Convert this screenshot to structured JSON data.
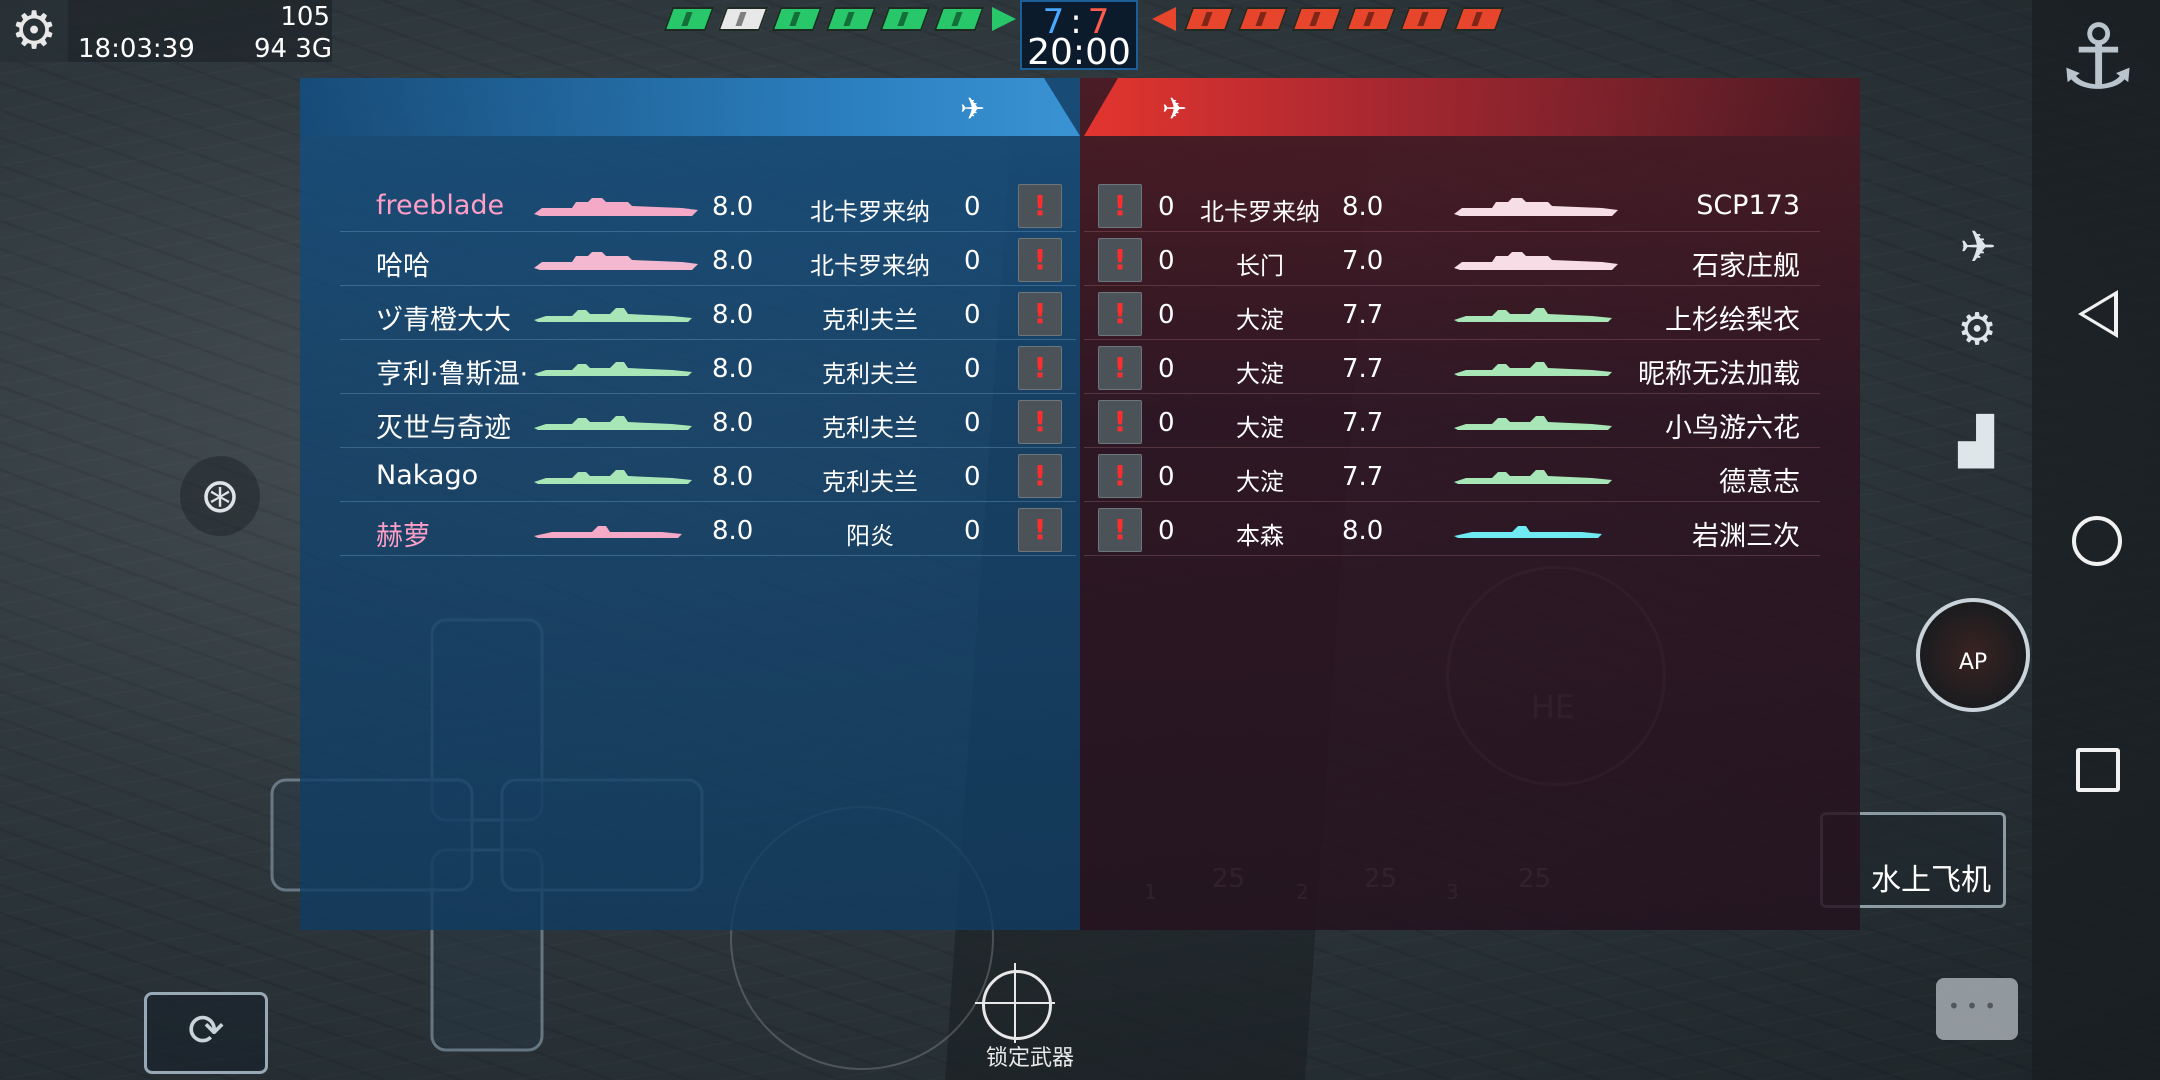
{
  "status": {
    "clock": "18:03:39",
    "fps": "105",
    "ping": "94",
    "network": "3G"
  },
  "score": {
    "blue": "7",
    "sep": ":",
    "red": "7",
    "timer": "20:00"
  },
  "colors": {
    "blue_team": "#2b7fbf",
    "red_team": "#e4352f",
    "blue_flag": "#27c76a",
    "red_flag": "#e7452c",
    "report_mark": "#ff2e2e"
  },
  "blue_team": {
    "header_icon": "airplane-icon",
    "players": [
      {
        "name": "freeblade",
        "tier": "8.0",
        "ship": "北卡罗来纳",
        "damage": "0",
        "highlight": true,
        "class": "battleship"
      },
      {
        "name": "哈哈",
        "tier": "8.0",
        "ship": "北卡罗来纳",
        "damage": "0",
        "highlight": false,
        "class": "battleship"
      },
      {
        "name": "ヅ青橙大大",
        "tier": "8.0",
        "ship": "克利夫兰",
        "damage": "0",
        "highlight": false,
        "class": "cruiser"
      },
      {
        "name": "亨利·鲁斯温·",
        "tier": "8.0",
        "ship": "克利夫兰",
        "damage": "0",
        "highlight": false,
        "class": "cruiser"
      },
      {
        "name": "灭世与奇迹",
        "tier": "8.0",
        "ship": "克利夫兰",
        "damage": "0",
        "highlight": false,
        "class": "cruiser"
      },
      {
        "name": "Nakago",
        "tier": "8.0",
        "ship": "克利夫兰",
        "damage": "0",
        "highlight": false,
        "class": "cruiser"
      },
      {
        "name": "赫萝",
        "tier": "8.0",
        "ship": "阳炎",
        "damage": "0",
        "highlight": true,
        "class": "destroyer"
      }
    ]
  },
  "red_team": {
    "header_icon": "airplane-icon",
    "players": [
      {
        "name": "SCP173",
        "tier": "8.0",
        "ship": "北卡罗来纳",
        "damage": "0",
        "class": "battleship"
      },
      {
        "name": "石家庄舰",
        "tier": "7.0",
        "ship": "长门",
        "damage": "0",
        "class": "battleship"
      },
      {
        "name": "上杉绘梨衣",
        "tier": "7.7",
        "ship": "大淀",
        "damage": "0",
        "class": "cruiser"
      },
      {
        "name": "昵称无法加载",
        "tier": "7.7",
        "ship": "大淀",
        "damage": "0",
        "class": "cruiser"
      },
      {
        "name": "小鸟游六花",
        "tier": "7.7",
        "ship": "大淀",
        "damage": "0",
        "class": "cruiser"
      },
      {
        "name": "德意志",
        "tier": "7.7",
        "ship": "大淀",
        "damage": "0",
        "class": "cruiser"
      },
      {
        "name": "岩渊三次",
        "tier": "8.0",
        "ship": "本森",
        "damage": "0",
        "class": "destroyer"
      }
    ]
  },
  "report_mark": "!",
  "controls": {
    "ammo_ap": "AP",
    "ammo_he": "HE",
    "seaplane": "水上飞机",
    "lock_weapon": "锁定武器",
    "ammo_counts": [
      "25",
      "25",
      "25"
    ],
    "ammo_slots": [
      "1",
      "2",
      "3"
    ]
  }
}
